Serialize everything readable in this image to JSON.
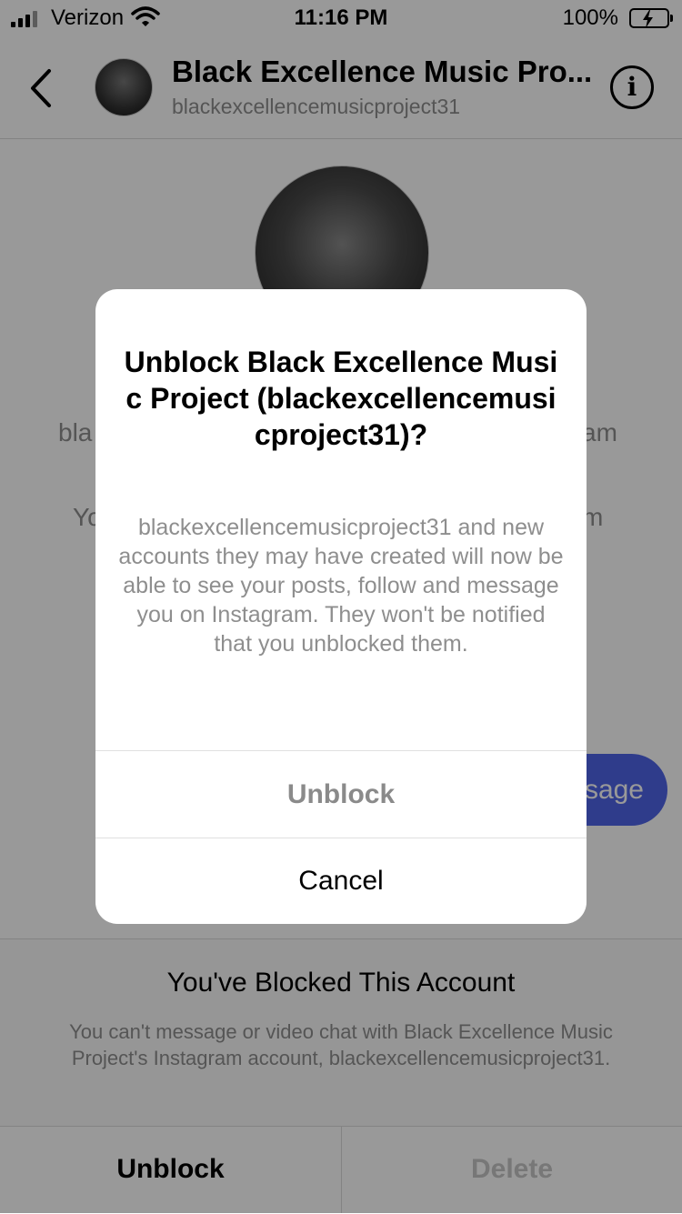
{
  "status_bar": {
    "carrier": "Verizon",
    "time": "11:16 PM",
    "battery": "100%"
  },
  "header": {
    "title": "Black Excellence Music Pro...",
    "username": "blackexcellencemusicproject31",
    "back_icon": "chevron-left-icon",
    "info_icon": "info-icon"
  },
  "background": {
    "line1_left": "bla",
    "line1_right": "am",
    "line2_left": "Yo",
    "line2_right": "m",
    "view_profile_partial": "sage"
  },
  "modal": {
    "title": "Unblock Black Excellence Music Project (blackexcellencemusicproject31)?",
    "body": "blackexcellencemusicproject31 and new accounts they may have created will now be able to see your posts, follow and message you on Instagram. They won't be notified that you unblocked them.",
    "unblock_label": "Unblock",
    "cancel_label": "Cancel"
  },
  "blocked": {
    "title": "You've Blocked This Account",
    "description": "You can't message or video chat with Black Excellence Music Project's Instagram account, blackexcellencemusicproject31."
  },
  "bottom": {
    "unblock_label": "Unblock",
    "delete_label": "Delete"
  },
  "colors": {
    "accent": "#4f64e8",
    "secondary_text": "#8e8e8e"
  }
}
